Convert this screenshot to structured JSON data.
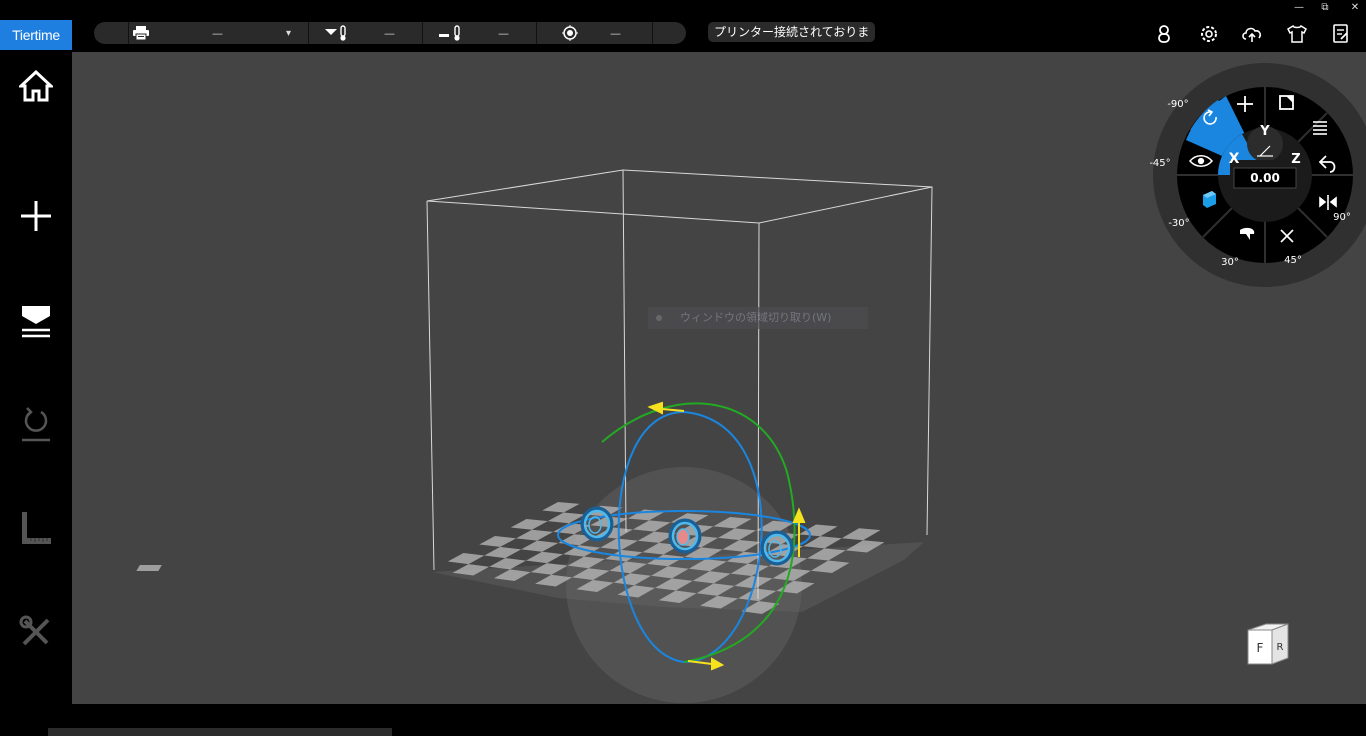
{
  "app": {
    "logo_text": "Tiertime"
  },
  "window_controls": {
    "minimize": "—",
    "restore": "⧉",
    "close": "✕"
  },
  "toolbar": {
    "printer_value": "—",
    "printer_dropdown_arrow": "▾",
    "nozzle_temp_value": "—",
    "platform_temp_value": "—",
    "target_value": "—",
    "connection_status": "プリンター接続されておりま",
    "icons": [
      "account-icon",
      "settings-icon",
      "cloud-icon",
      "tshirt-icon",
      "document-icon"
    ]
  },
  "sidebar": {
    "items": [
      {
        "name": "home",
        "icon": "home-icon"
      },
      {
        "name": "add",
        "icon": "plus-icon"
      },
      {
        "name": "print",
        "icon": "print-icon"
      },
      {
        "name": "calibrate",
        "icon": "calibrate-icon"
      },
      {
        "name": "measure",
        "icon": "ruler-icon"
      },
      {
        "name": "tools",
        "icon": "tools-icon"
      }
    ]
  },
  "viewport": {
    "ghost_menu_text": "ウィンドウの領域切り取り(W)",
    "view_cube": {
      "front": "F",
      "right": "R"
    }
  },
  "radial_menu": {
    "axis_x": "X",
    "axis_y": "Y",
    "axis_z": "Z",
    "value": "0.00",
    "presets": {
      "neg90": "-90°",
      "neg45": "-45°",
      "neg30": "-30°",
      "pos30": "30°",
      "pos45": "45°",
      "pos90": "90°"
    },
    "accent_color": "#1a86e0"
  }
}
